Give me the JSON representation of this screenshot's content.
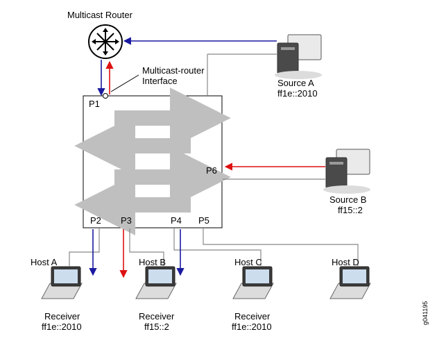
{
  "title": "Multicast Router",
  "interface_label": "Multicast-router Interface",
  "switch": {
    "ports": {
      "p1": "P1",
      "p2": "P2",
      "p3": "P3",
      "p4": "P4",
      "p5": "P5",
      "p6": "P6"
    }
  },
  "sources": {
    "a": {
      "name": "Source A",
      "group": "ff1e::2010"
    },
    "b": {
      "name": "Source B",
      "group": "ff15::2"
    }
  },
  "hosts": {
    "a": {
      "name": "Host A",
      "role": "Receiver",
      "group": "ff1e::2010"
    },
    "b": {
      "name": "Host B",
      "role": "Receiver",
      "group": "ff15::2"
    },
    "c": {
      "name": "Host C",
      "role": "Receiver",
      "group": "ff1e::2010"
    },
    "d": {
      "name": "Host D"
    }
  },
  "figure_id": "g041195"
}
